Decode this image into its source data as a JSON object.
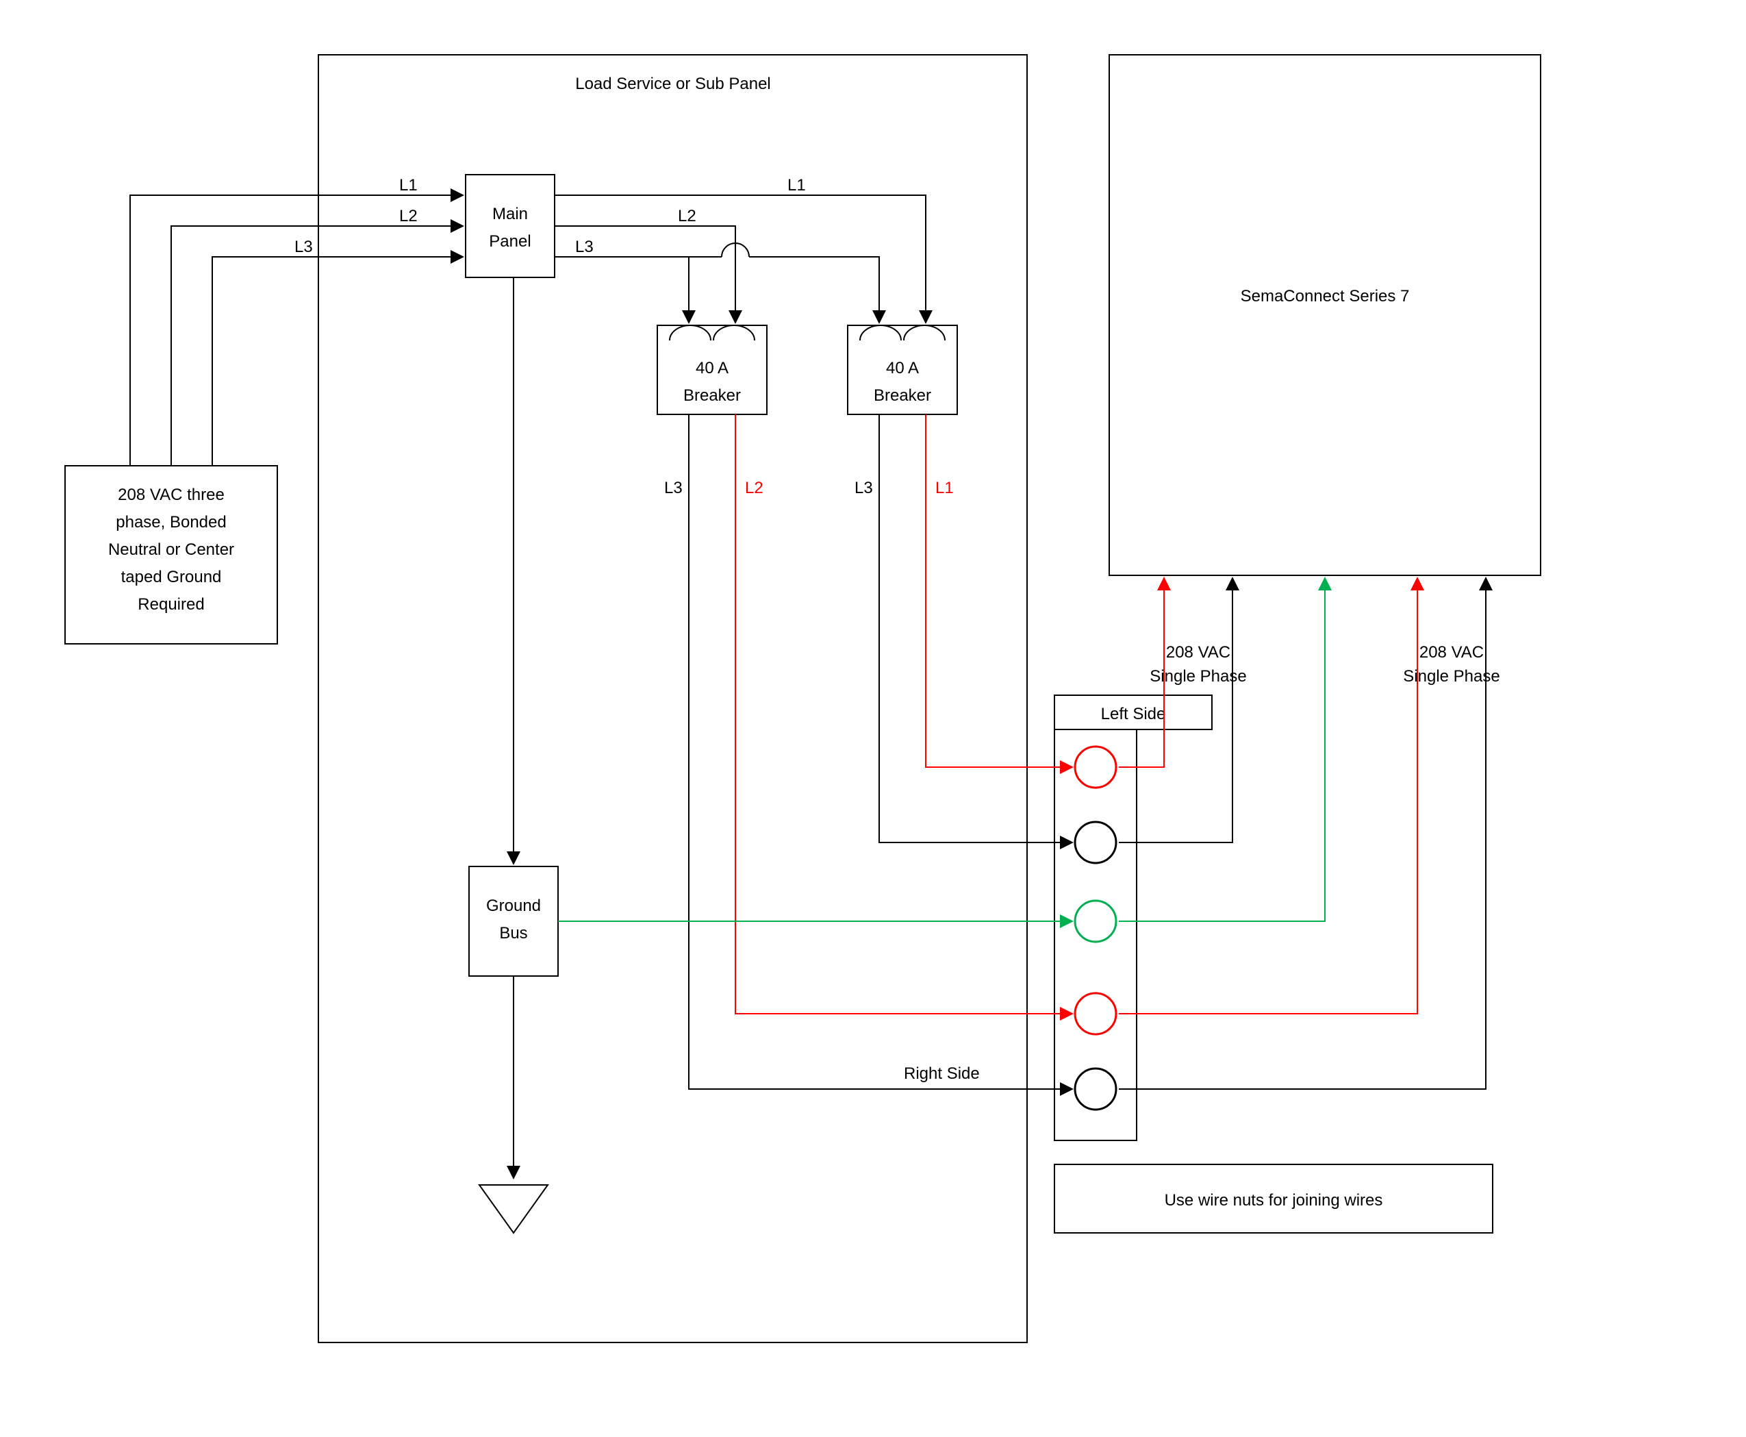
{
  "panelTitle": "Load Service or Sub Panel",
  "source": {
    "line1": "208 VAC three",
    "line2": "phase, Bonded",
    "line3": "Neutral or Center",
    "line4": "taped Ground",
    "line5": "Required"
  },
  "lines": {
    "L1": "L1",
    "L2": "L2",
    "L3": "L3"
  },
  "mainPanel": {
    "line1": "Main",
    "line2": "Panel"
  },
  "breaker1": {
    "line1": "40 A",
    "line2": "Breaker"
  },
  "breaker2": {
    "line1": "40 A",
    "line2": "Breaker"
  },
  "breakerOut": {
    "left1": "L3",
    "left2": "L2",
    "right1": "L3",
    "right2": "L1"
  },
  "groundBus": {
    "line1": "Ground",
    "line2": "Bus"
  },
  "sides": {
    "left": "Left Side",
    "right": "Right Side"
  },
  "device": "SemaConnect Series 7",
  "vac": {
    "line1": "208 VAC",
    "line2": "Single Phase"
  },
  "note": "Use wire nuts for joining wires"
}
